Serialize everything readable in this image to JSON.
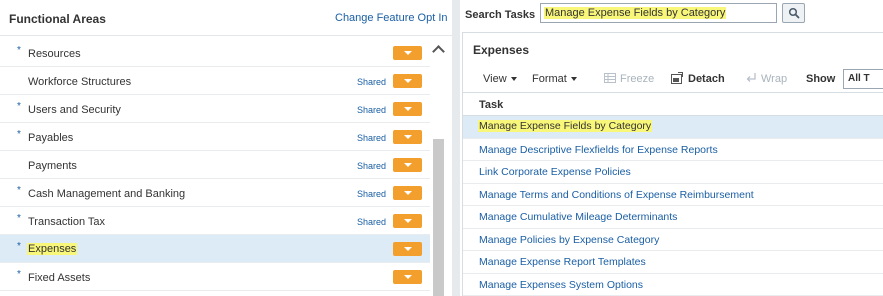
{
  "left": {
    "title": "Functional Areas",
    "change_opt": "Change Feature Opt In",
    "areas": [
      {
        "label": "Resources",
        "required": true,
        "shared": ""
      },
      {
        "label": "Workforce Structures",
        "required": false,
        "shared": "Shared"
      },
      {
        "label": "Users and Security",
        "required": true,
        "shared": "Shared"
      },
      {
        "label": "Payables",
        "required": true,
        "shared": "Shared"
      },
      {
        "label": "Payments",
        "required": false,
        "shared": "Shared"
      },
      {
        "label": "Cash Management and Banking",
        "required": true,
        "shared": "Shared"
      },
      {
        "label": "Transaction Tax",
        "required": true,
        "shared": "Shared"
      },
      {
        "label": "Expenses",
        "required": true,
        "shared": "",
        "selected": true
      },
      {
        "label": "Fixed Assets",
        "required": true,
        "shared": ""
      }
    ],
    "star": "*"
  },
  "search": {
    "label": "Search Tasks",
    "value": "Manage Expense Fields by Category"
  },
  "expenses": {
    "title": "Expenses",
    "toolbar": {
      "view": "View",
      "format": "Format",
      "freeze": "Freeze",
      "detach": "Detach",
      "wrap": "Wrap",
      "show": "Show",
      "show_value": "All T"
    },
    "column": "Task",
    "tasks": [
      "Manage Expense Fields by Category",
      "Manage Descriptive Flexfields for Expense Reports",
      "Link Corporate Expense Policies",
      "Manage Terms and Conditions of Expense Reimbursement",
      "Manage Cumulative Mileage Determinants",
      "Manage Policies by Expense Category",
      "Manage Expense Report Templates",
      "Manage Expenses System Options"
    ]
  },
  "colors": {
    "link": "#1a5fa5",
    "accent_orange": "#f29f2e",
    "highlight": "#f9f77a",
    "selected_row": "#ddebf7"
  }
}
